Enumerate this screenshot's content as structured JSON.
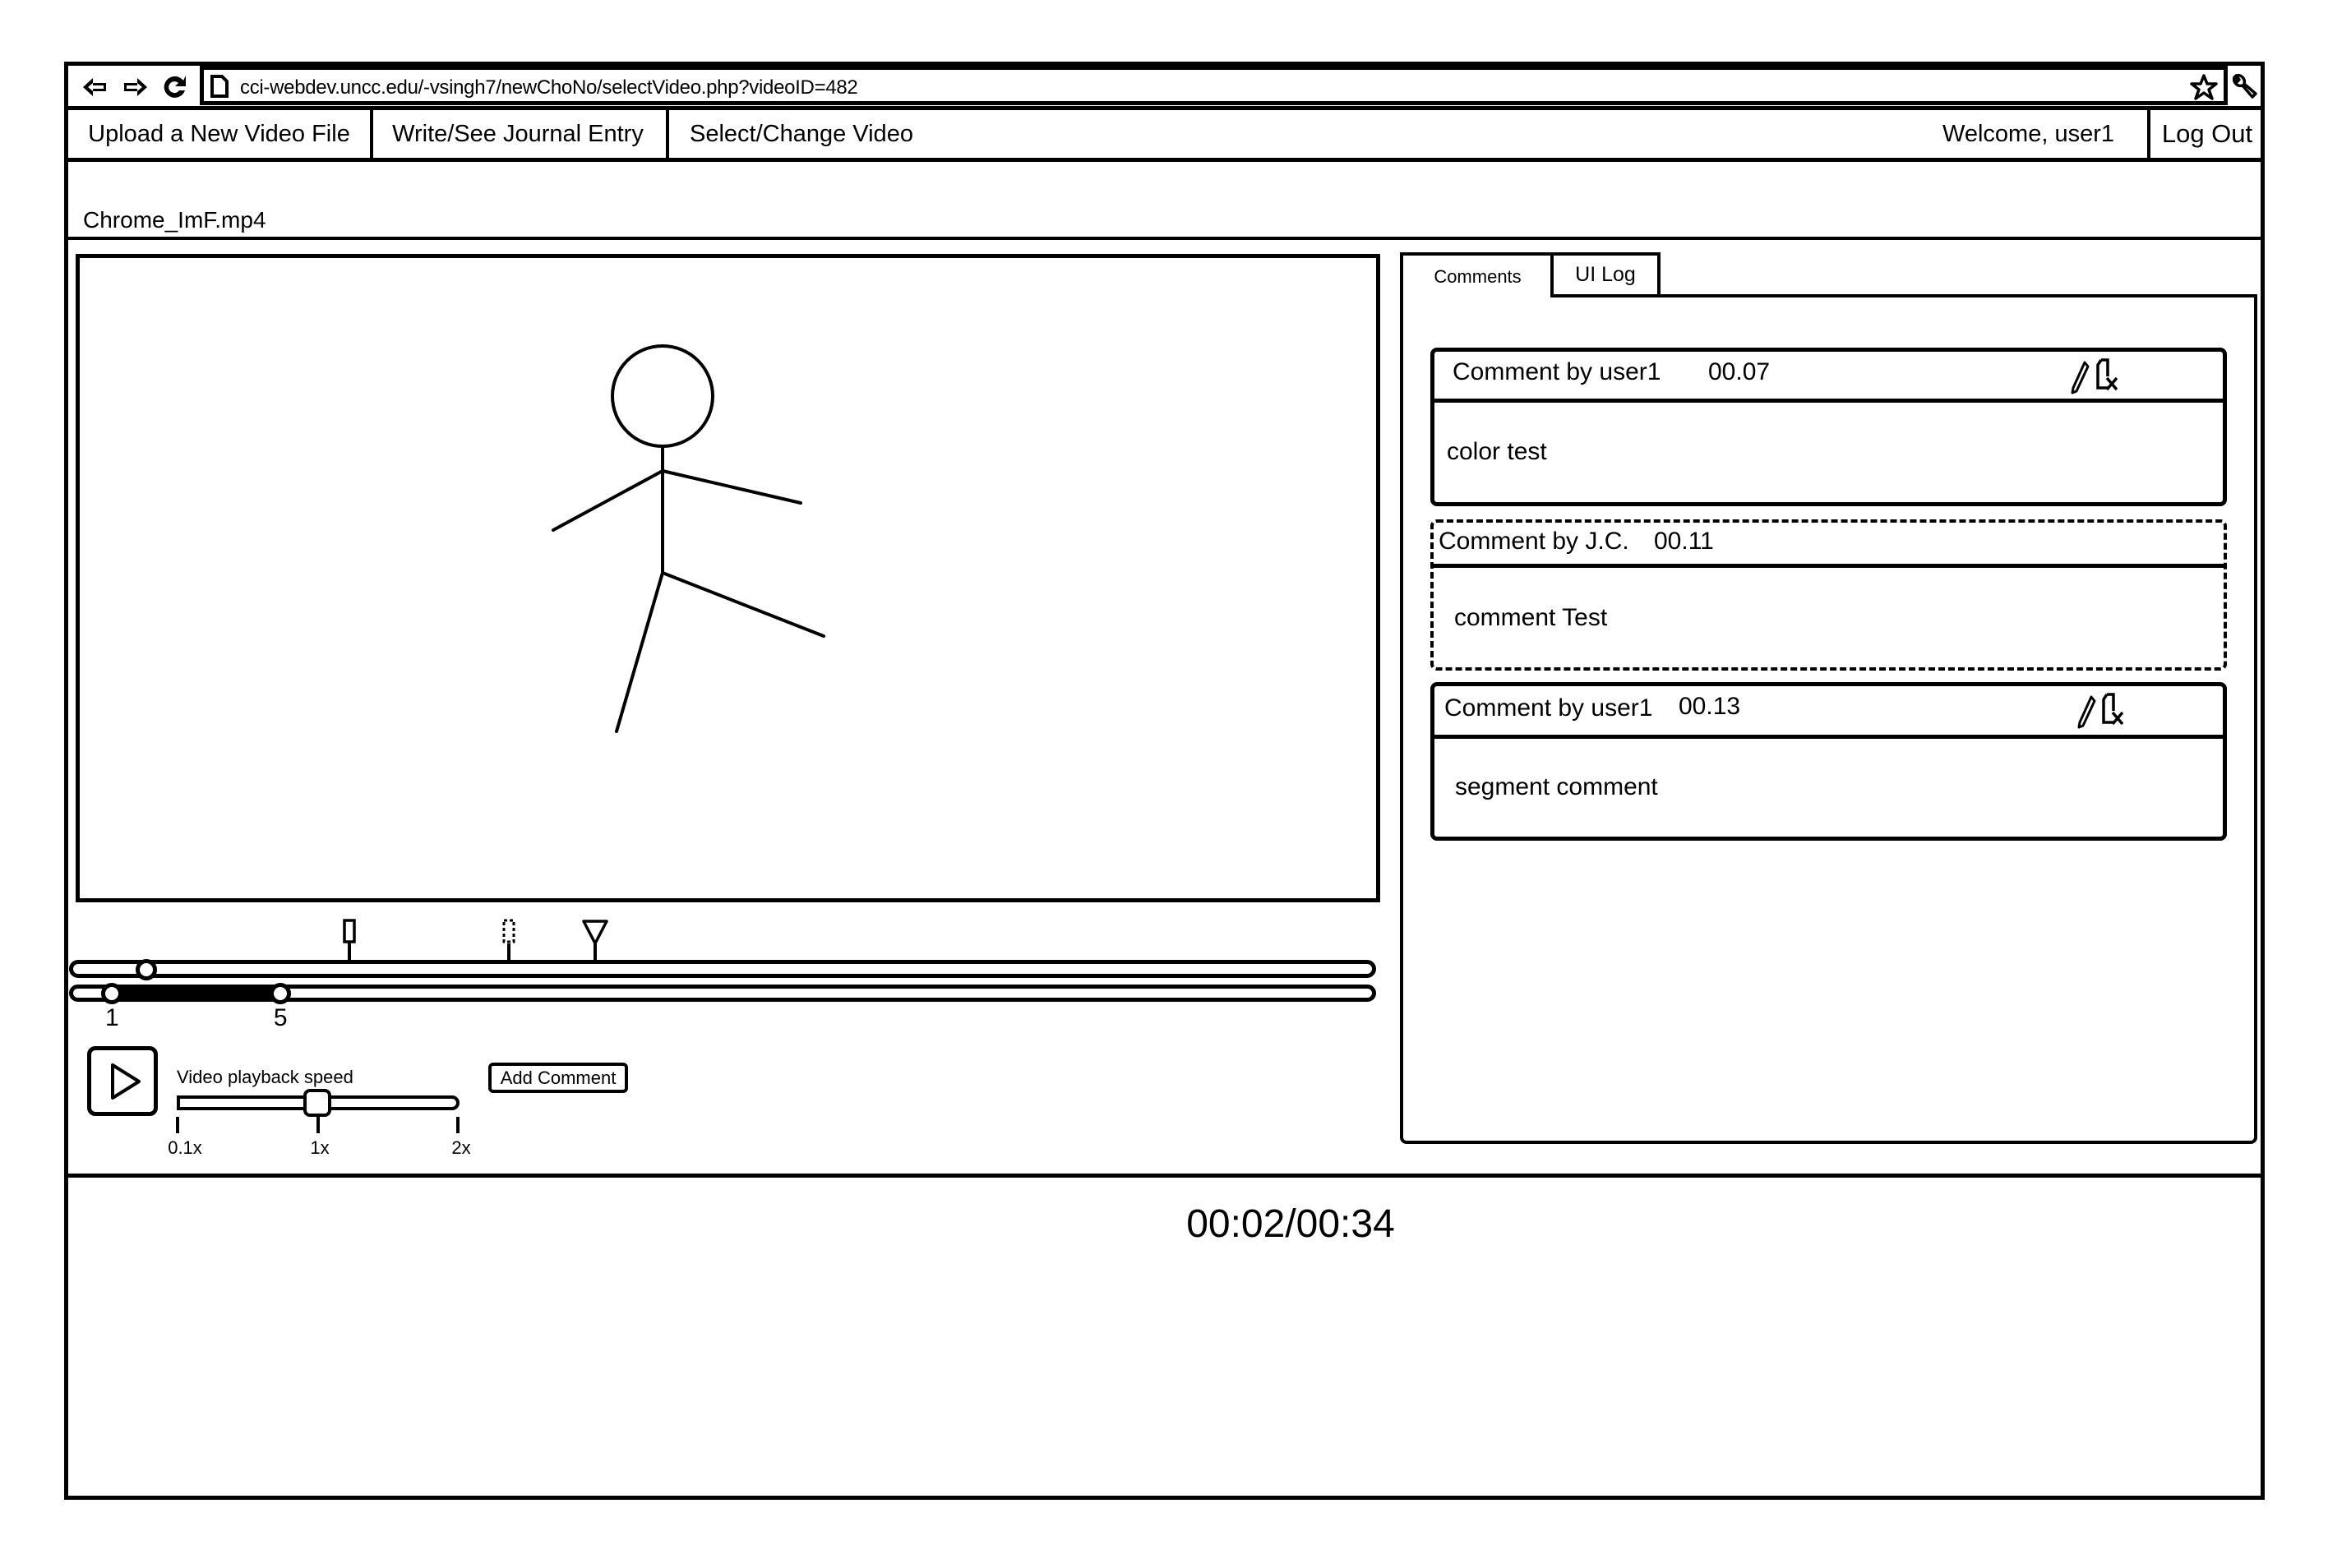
{
  "browser": {
    "url": "cci-webdev.uncc.edu/-vsingh7/newChoNo/selectVideo.php?videoID=482",
    "icons": [
      "back-arrow-icon",
      "forward-arrow-icon",
      "reload-icon",
      "page-icon",
      "star-icon",
      "wrench-icon"
    ]
  },
  "nav": {
    "upload_label": "Upload a New Video File",
    "journal_label": "Write/See Journal Entry",
    "select_label": "Select/Change Video",
    "welcome_text": "Welcome, user1",
    "logout_label": "Log Out"
  },
  "video": {
    "filename": "Chrome_ImF.mp4",
    "current_time": "00:02",
    "duration": "00:34",
    "time_display": "00:02/00:34",
    "playback_fraction": 0.059
  },
  "timeline": {
    "markers": [
      {
        "type": "comment",
        "style": "solid",
        "fraction": 0.215
      },
      {
        "type": "comment",
        "style": "dashed",
        "fraction": 0.337
      },
      {
        "type": "segment",
        "style": "triangle",
        "fraction": 0.403
      }
    ],
    "segment_range": {
      "start_label": "1",
      "end_label": "5",
      "start_fraction": 0.033,
      "end_fraction": 0.162
    }
  },
  "controls": {
    "play_icon": "play-icon",
    "speed_label": "Video playback speed",
    "speed_ticks": [
      "0.1x",
      "1x",
      "2x"
    ],
    "speed_value": "1x",
    "add_comment_label": "Add Comment"
  },
  "panel": {
    "tabs": [
      {
        "label": "Comments",
        "active": true
      },
      {
        "label": "UI Log",
        "active": false
      }
    ],
    "comments": [
      {
        "author_line": "Comment by user1",
        "time": "00.07",
        "body": "color test",
        "editable": true,
        "style": "solid"
      },
      {
        "author_line": "Comment by J.C.",
        "time": "00.11",
        "body": "comment Test",
        "editable": false,
        "style": "dashed"
      },
      {
        "author_line": "Comment by user1",
        "time": "00.13",
        "body": "segment comment",
        "editable": true,
        "style": "solid"
      }
    ]
  }
}
